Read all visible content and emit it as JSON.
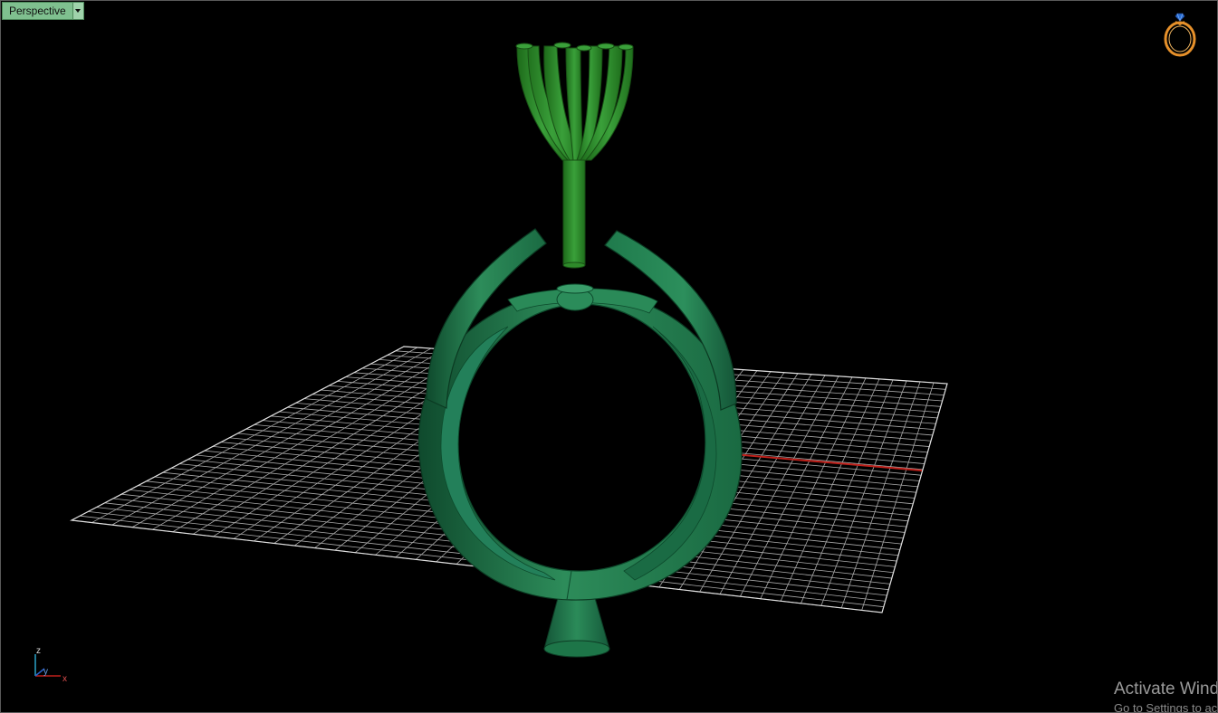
{
  "viewport": {
    "name": "Perspective",
    "background": "#000000",
    "grid_color": "#bdbdbd",
    "x_axis_color": "#c0201a",
    "y_axis_color": "#2aa3c8",
    "model_color": "#1f7a4c",
    "prongs_color": "#2f8a2a",
    "tab_color": "#7fc08f"
  },
  "axis_widget": {
    "z": "z",
    "y": "y",
    "x": "x"
  },
  "icons": {
    "view_logo": "ring-icon",
    "view_menu": "chevron-down-icon"
  },
  "watermark": {
    "title": "Activate Windows",
    "subtitle": "Go to Settings to activate Windows."
  }
}
